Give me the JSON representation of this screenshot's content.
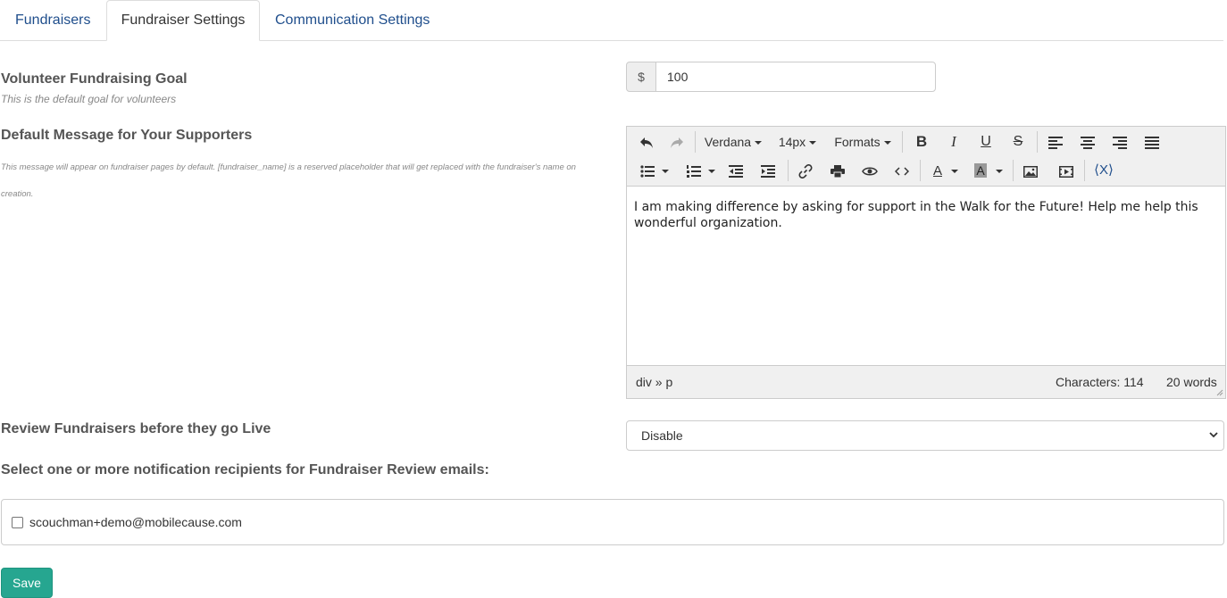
{
  "tabs": [
    {
      "label": "Fundraisers",
      "active": false
    },
    {
      "label": "Fundraiser Settings",
      "active": true
    },
    {
      "label": "Communication Settings",
      "active": false
    }
  ],
  "goal": {
    "label": "Volunteer Fundraising Goal",
    "help": "This is the default goal for volunteers",
    "currency_symbol": "$",
    "value": "100"
  },
  "message": {
    "label": "Default Message for Your Supporters",
    "help": "This message will appear on fundraiser pages by default. [fundraiser_name] is a reserved placeholder that will get replaced with the fundraiser's name on creation."
  },
  "editor": {
    "font_family": "Verdana",
    "font_size": "14px",
    "formats_label": "Formats",
    "content": "I am making difference by asking for support in the Walk for the Future! Help me help this wonderful organization.",
    "path": "div » p",
    "characters": "Characters: 114",
    "words": "20 words",
    "toolbar_icons": [
      "undo-icon",
      "redo-icon",
      "bold-icon",
      "italic-icon",
      "underline-icon",
      "strikethrough-icon",
      "align-left-icon",
      "align-center-icon",
      "align-right-icon",
      "align-justify-icon",
      "bullet-list-icon",
      "numbered-list-icon",
      "outdent-icon",
      "indent-icon",
      "link-icon",
      "print-icon",
      "preview-icon",
      "code-icon",
      "text-color-icon",
      "background-color-icon",
      "image-icon",
      "media-icon",
      "variable-icon"
    ]
  },
  "review": {
    "label": "Review Fundraisers before they go Live",
    "selected": "Disable"
  },
  "recipients": {
    "label": "Select one or more notification recipients for Fundraiser Review emails:",
    "items": [
      {
        "email": "scouchman+demo@mobilecause.com",
        "checked": false
      }
    ]
  },
  "save_label": "Save",
  "colors": {
    "primary": "#26a690",
    "link": "#1f4e8c"
  }
}
